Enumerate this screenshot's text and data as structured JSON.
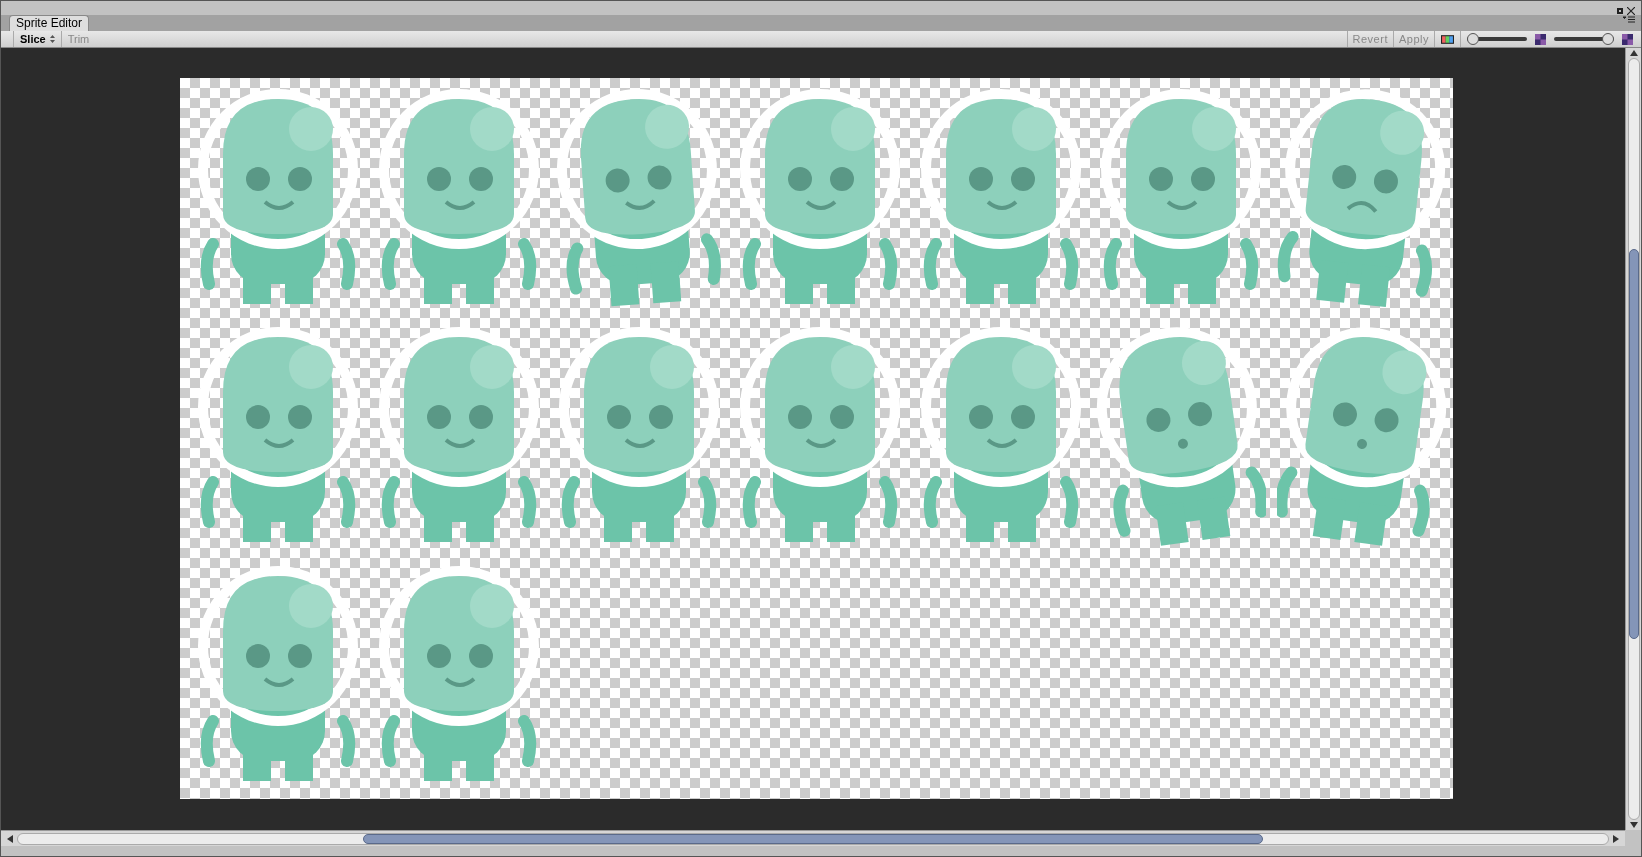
{
  "window": {
    "tab": "Sprite Editor"
  },
  "toolbar": {
    "left": [
      {
        "label": "Slice",
        "kind": "dropdown",
        "disabled": false
      },
      {
        "label": "Trim",
        "kind": "button",
        "disabled": true
      }
    ],
    "right": [
      {
        "label": "Revert",
        "disabled": true
      },
      {
        "label": "Apply",
        "disabled": true
      }
    ],
    "sliders": [
      {
        "level": 0
      },
      {
        "level": 1
      }
    ]
  }
}
